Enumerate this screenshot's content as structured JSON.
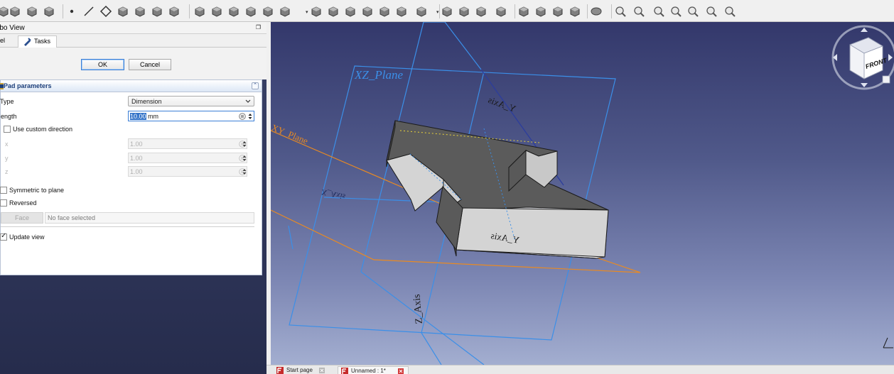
{
  "toolbar": {
    "icons": [
      "part-icon",
      "sketch-icon",
      "import-icon",
      "cube-icon",
      "point-icon",
      "line-icon",
      "plane-icon",
      "lcs-icon",
      "shape-binder-icon",
      "subshape-binder-icon",
      "clone-icon",
      "pad-icon",
      "revolve-icon",
      "loft-icon",
      "pipe-icon",
      "helix-icon",
      "additive-primitive-icon",
      "pocket-icon",
      "hole-icon",
      "groove-icon",
      "subtractive-loft-icon",
      "subtractive-pipe-icon",
      "subtractive-helix-icon",
      "subtractive-primitive-icon",
      "mirrored-icon",
      "linear-pattern-icon",
      "polar-pattern-icon",
      "multitransform-icon",
      "fillet-icon",
      "chamfer-icon",
      "draft-icon",
      "thickness-icon",
      "boolean-icon",
      "measure-linear-icon",
      "measure-angular-icon",
      "measure-refresh-icon",
      "measure-clear-icon",
      "measure-toggle-all-icon",
      "measure-toggle-3d-icon",
      "measure-toggle-delta-icon"
    ]
  },
  "combo_view": {
    "title": "mbo View",
    "tabs": [
      "del",
      "Tasks"
    ]
  },
  "buttons": {
    "ok": "OK",
    "cancel": "Cancel"
  },
  "pad": {
    "title": "Pad parameters",
    "type_label": "Type",
    "type_value": "Dimension",
    "length_label": "ength",
    "length_value_selected": "10.00",
    "length_unit": " mm",
    "custom_direction_label": "Use custom direction",
    "x_label": "x",
    "y_label": "y",
    "z_label": "z",
    "x_value": "1.00",
    "y_value": "1.00",
    "z_value": "1.00",
    "symmetric_label": "Symmetric to plane",
    "reversed_label": "Reversed",
    "face_button": "Face",
    "face_field": "No face selected",
    "update_view_label": "Update view",
    "custom_direction_checked": false,
    "symmetric_checked": false,
    "reversed_checked": false,
    "update_view_checked": true
  },
  "viewport": {
    "xz_plane_label": "XZ_Plane",
    "xy_plane_label": "XY_Plane",
    "x_axis_label": "X_Axis",
    "z_axis_label": "Z_Axis",
    "y_axis_label_top": "Y_Axis",
    "y_axis_label_front": "Y_Axis",
    "navcube_face": "FRONT",
    "plane_color_blue": "#3b8fe8",
    "plane_color_orange": "#e98a22"
  },
  "document_tabs": [
    {
      "label": "Start page"
    },
    {
      "label": "Unnamed : 1*"
    }
  ]
}
